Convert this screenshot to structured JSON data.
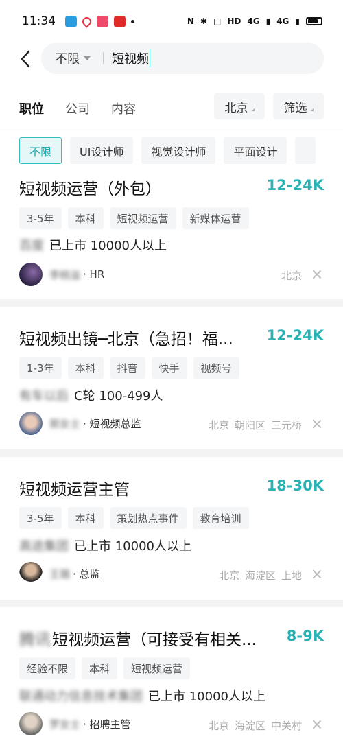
{
  "status": {
    "time": "11:34",
    "hd": "HD",
    "net1": "4G",
    "net2": "4G"
  },
  "search": {
    "scope": "不限",
    "query": "短视频"
  },
  "tabs": [
    "职位",
    "公司",
    "内容"
  ],
  "filters": {
    "city": "北京",
    "filter": "筛选"
  },
  "chips": [
    "不限",
    "UI设计师",
    "视觉设计师",
    "平面设计"
  ],
  "jobs": [
    {
      "title": "短视频运营（外包）",
      "salary": "12-24K",
      "tags": [
        "3-5年",
        "本科",
        "短视频运营",
        "新媒体运营"
      ],
      "company_name": "百度",
      "company_info": "已上市 10000人以上",
      "recruiter_name": "李桃溢",
      "recruiter_role": "· HR",
      "location": [
        "北京"
      ]
    },
    {
      "title": "短视频出镜─北京（急招！福...",
      "salary": "12-24K",
      "tags": [
        "1-3年",
        "本科",
        "抖音",
        "快手",
        "视频号"
      ],
      "company_name": "有车以后",
      "company_info": "C轮 100-499人",
      "recruiter_name": "郭女士",
      "recruiter_role": "· 短视频总监",
      "location": [
        "北京",
        "朝阳区",
        "三元桥"
      ]
    },
    {
      "title": "短视频运营主管",
      "salary": "18-30K",
      "tags": [
        "3-5年",
        "本科",
        "策划热点事件",
        "教育培训"
      ],
      "company_name": "高途集团",
      "company_info": "已上市 10000人以上",
      "recruiter_name": "王璐",
      "recruiter_role": "· 总监",
      "location": [
        "北京",
        "海淀区",
        "上地"
      ]
    },
    {
      "title": "短视频运营（可接受有相关...",
      "title_prefix": "腾讯",
      "salary": "8-9K",
      "tags": [
        "经验不限",
        "本科",
        "短视频运营"
      ],
      "company_name": "联通动力信息技术集团",
      "company_info": "已上市 10000人以上",
      "recruiter_name": "罗女士",
      "recruiter_role": "· 招聘主管",
      "location": [
        "北京",
        "海淀区",
        "中关村"
      ]
    }
  ]
}
